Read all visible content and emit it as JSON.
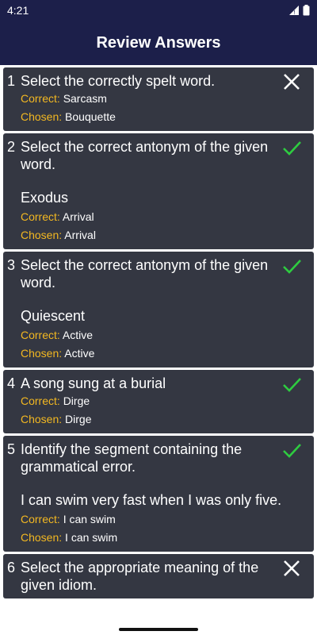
{
  "status": {
    "time": "4:21"
  },
  "header": {
    "title": "Review Answers"
  },
  "colors": {
    "bar": "#1c1f4a",
    "card": "#343742",
    "label": "#f3b821",
    "correct": "#2ecc40",
    "wrong": "#ffffff"
  },
  "labels": {
    "correct": "Correct:",
    "chosen": "Chosen:"
  },
  "questions": [
    {
      "num": "1",
      "question": "Select the correctly spelt word.",
      "extra": "",
      "correct": "Sarcasm",
      "chosen": "Bouquette",
      "result": "wrong"
    },
    {
      "num": "2",
      "question": "Select the correct antonym of the given word.",
      "extra": "Exodus",
      "correct": "Arrival",
      "chosen": "Arrival",
      "result": "right"
    },
    {
      "num": "3",
      "question": "Select the correct antonym of the given word.",
      "extra": "Quiescent",
      "correct": "Active",
      "chosen": "Active",
      "result": "right"
    },
    {
      "num": "4",
      "question": "A song sung at a burial",
      "extra": "",
      "correct": "Dirge",
      "chosen": "Dirge",
      "result": "right"
    },
    {
      "num": "5",
      "question": "Identify the segment containing the grammatical error.",
      "extra": "I can swim very fast when I was only five.",
      "correct": "I can swim",
      "chosen": "I can swim",
      "result": "right"
    },
    {
      "num": "6",
      "question": "Select the appropriate meaning of the given idiom.",
      "extra": "",
      "correct": "",
      "chosen": "",
      "result": "wrong"
    }
  ]
}
